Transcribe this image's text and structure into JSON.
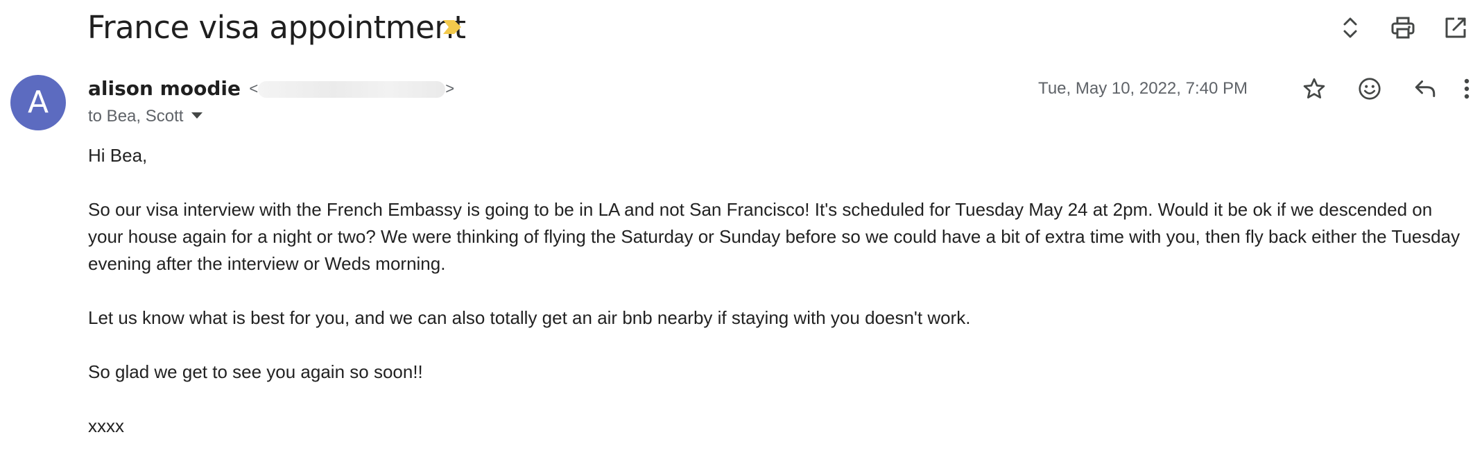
{
  "subject": "France visa appointment",
  "icons": {
    "importance": "importance-marker-icon",
    "expand": "expand-collapse-icon",
    "print": "print-icon",
    "open_new_window": "open-in-new-window-icon",
    "star": "star-icon",
    "emoji": "add-reaction-icon",
    "reply": "reply-icon",
    "more": "more-vertical-icon"
  },
  "colors": {
    "avatar_bg": "#5c6bc0",
    "importance": "#f2c94c"
  },
  "sender": {
    "avatar_letter": "A",
    "name": "alison moodie",
    "email_open": "<",
    "email_close": ">"
  },
  "recipients": "to Bea, Scott",
  "date": "Tue, May 10, 2022, 7:40 PM",
  "body": {
    "greeting": "Hi Bea,",
    "p1": "So our visa interview with the French Embassy is going to be in LA and not San Francisco! It's scheduled for Tuesday May 24 at 2pm. Would it be ok if we descended on your house again for a night or two? We were thinking of flying the Saturday or Sunday before so we could have a bit of extra time with you, then fly back either the Tuesday evening after the interview or Weds morning.",
    "p2": "Let us know what is best for you, and we can also totally get an air bnb nearby if staying with you doesn't work.",
    "p3": "So glad we get to see you again so soon!!",
    "signoff": "xxxx"
  }
}
